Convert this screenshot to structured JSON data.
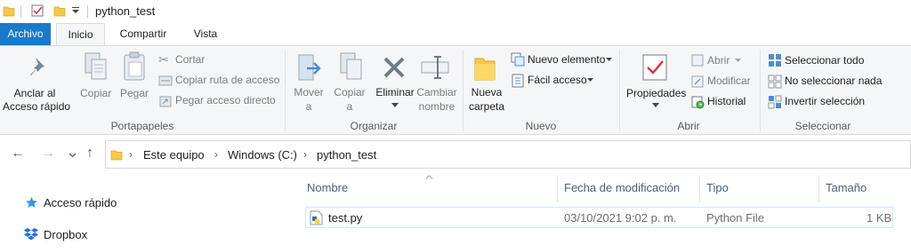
{
  "window": {
    "title": "python_test"
  },
  "tabs": [
    "Archivo",
    "Inicio",
    "Compartir",
    "Vista"
  ],
  "ribbon": {
    "portapapeles": {
      "label": "Portapapeles",
      "anclar": [
        "Anclar al",
        "Acceso rápido"
      ],
      "copiar": "Copiar",
      "pegar": "Pegar",
      "cortar": "Cortar",
      "copiar_ruta": "Copiar ruta de acceso",
      "pegar_acceso": "Pegar acceso directo"
    },
    "organizar": {
      "label": "Organizar",
      "mover": [
        "Mover",
        "a"
      ],
      "copiar": [
        "Copiar",
        "a"
      ],
      "eliminar": "Eliminar",
      "cambiar": [
        "Cambiar",
        "nombre"
      ]
    },
    "nuevo": {
      "label": "Nuevo",
      "nueva_carpeta": [
        "Nueva",
        "carpeta"
      ],
      "nuevo_elemento": "Nuevo elemento",
      "facil_acceso": "Fácil acceso"
    },
    "abrir": {
      "label": "Abrir",
      "propiedades": "Propiedades",
      "abrir": "Abrir",
      "modificar": "Modificar",
      "historial": "Historial"
    },
    "seleccionar": {
      "label": "Seleccionar",
      "todo": "Seleccionar todo",
      "nada": "No seleccionar nada",
      "invertir": "Invertir selección"
    }
  },
  "address": {
    "crumbs": [
      "Este equipo",
      "Windows (C:)",
      "python_test"
    ]
  },
  "columns": [
    "Nombre",
    "Fecha de modificación",
    "Tipo",
    "Tamaño"
  ],
  "files": [
    {
      "name": "test.py",
      "modified": "03/10/2021 9:02 p. m.",
      "type": "Python File",
      "size": "1 KB"
    }
  ],
  "nav": [
    "Acceso rápido",
    "Dropbox"
  ],
  "colors": {
    "accent": "#1979ca",
    "folder": "#f8c84a",
    "selection_border": "#cce8ff"
  }
}
